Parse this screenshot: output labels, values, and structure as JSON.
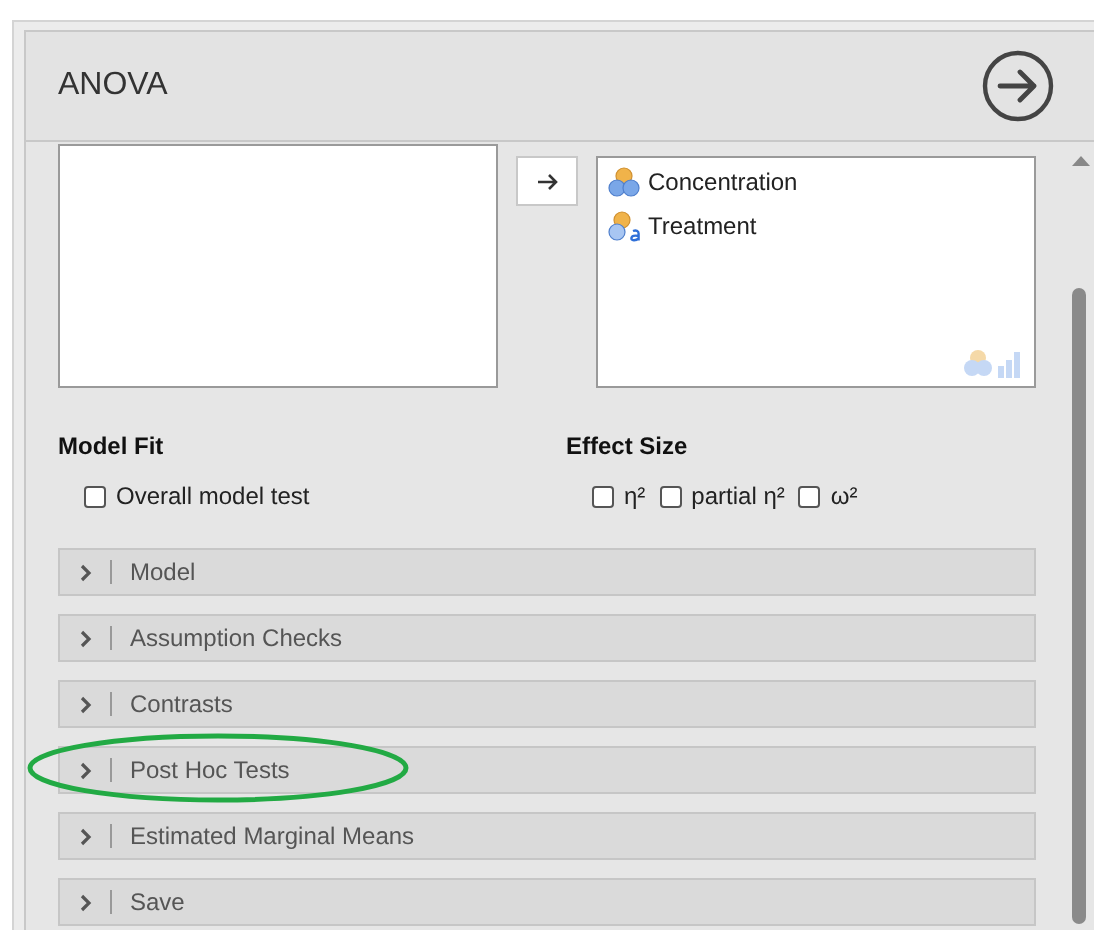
{
  "panel": {
    "title": "ANOVA"
  },
  "fixed_factors": [
    {
      "name": "Concentration",
      "kind": "nominal"
    },
    {
      "name": "Treatment",
      "kind": "text"
    }
  ],
  "model_fit": {
    "heading": "Model Fit",
    "options": [
      {
        "label": "Overall model test",
        "checked": false
      }
    ]
  },
  "effect_size": {
    "heading": "Effect Size",
    "options": [
      {
        "label": "η²",
        "checked": false
      },
      {
        "label": "partial η²",
        "checked": false
      },
      {
        "label": "ω²",
        "checked": false
      }
    ]
  },
  "sections": [
    {
      "label": "Model",
      "circled": false
    },
    {
      "label": "Assumption Checks",
      "circled": false
    },
    {
      "label": "Contrasts",
      "circled": false
    },
    {
      "label": "Post Hoc Tests",
      "circled": true
    },
    {
      "label": "Estimated Marginal Means",
      "circled": false
    },
    {
      "label": "Save",
      "circled": false
    }
  ]
}
